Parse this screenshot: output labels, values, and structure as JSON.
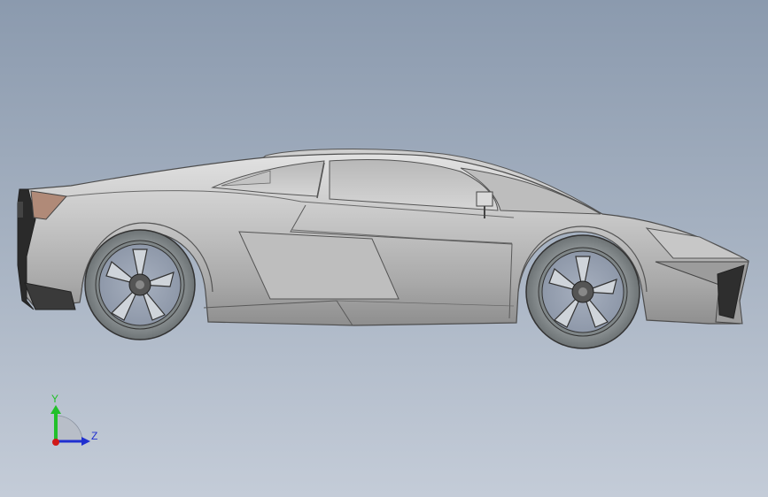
{
  "viewport": {
    "background_top": "#8b9aae",
    "background_bottom": "#c4ccd8"
  },
  "model": {
    "subject": "sports-car-3d-model",
    "view": "side"
  },
  "triad": {
    "y_label": "Y",
    "z_label": "Z",
    "y_color": "#22c02a",
    "z_color": "#1f2fd0",
    "x_color": "#d01818"
  }
}
